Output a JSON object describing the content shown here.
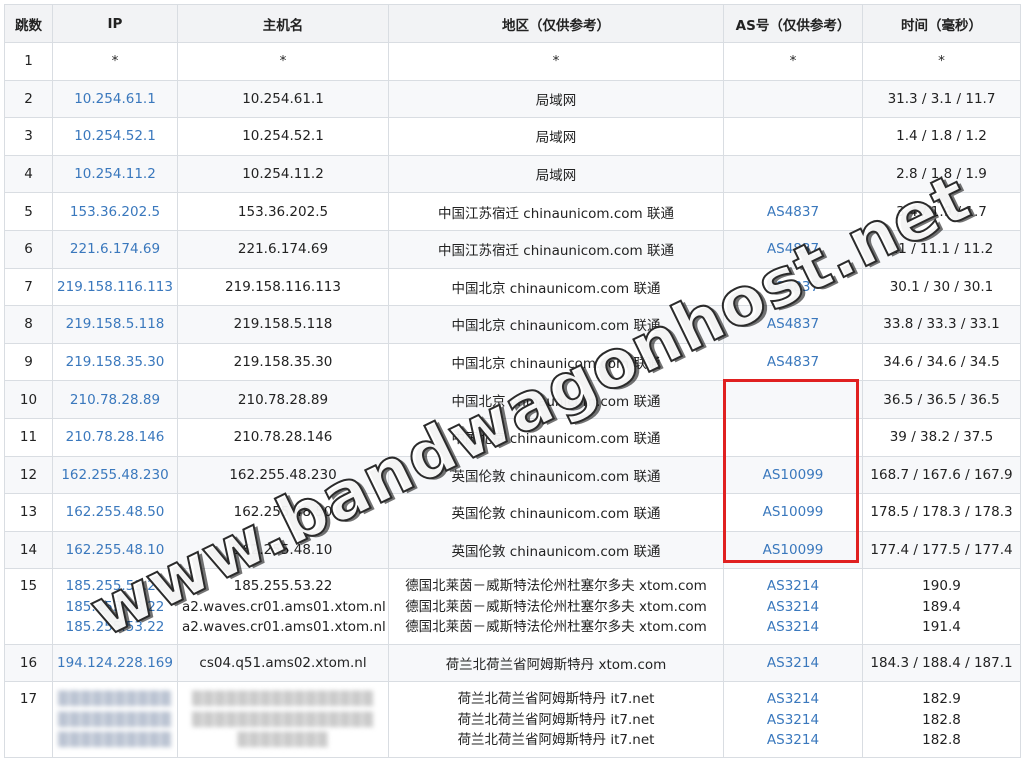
{
  "headers": {
    "hop": "跳数",
    "ip": "IP",
    "host": "主机名",
    "region": "地区（仅供参考）",
    "as": "AS号（仅供参考）",
    "time": "时间（毫秒）"
  },
  "rows": [
    {
      "hop": "1",
      "ips": [
        "*"
      ],
      "hosts": [
        "*"
      ],
      "regions": [
        "*"
      ],
      "as": [
        "*"
      ],
      "times": [
        "*"
      ]
    },
    {
      "hop": "2",
      "ips": [
        "10.254.61.1"
      ],
      "hosts": [
        "10.254.61.1"
      ],
      "regions": [
        "局域网"
      ],
      "as": [
        ""
      ],
      "times": [
        "31.3 / 3.1 / 11.7"
      ]
    },
    {
      "hop": "3",
      "ips": [
        "10.254.52.1"
      ],
      "hosts": [
        "10.254.52.1"
      ],
      "regions": [
        "局域网"
      ],
      "as": [
        ""
      ],
      "times": [
        "1.4 / 1.8 / 1.2"
      ]
    },
    {
      "hop": "4",
      "ips": [
        "10.254.11.2"
      ],
      "hosts": [
        "10.254.11.2"
      ],
      "regions": [
        "局域网"
      ],
      "as": [
        ""
      ],
      "times": [
        "2.8 / 1.8 / 1.9"
      ]
    },
    {
      "hop": "5",
      "ips": [
        "153.36.202.5"
      ],
      "hosts": [
        "153.36.202.5"
      ],
      "regions": [
        "中国江苏宿迁 chinaunicom.com 联通"
      ],
      "as": [
        "AS4837"
      ],
      "times": [
        "3.4 / 1.9 / 1.7"
      ]
    },
    {
      "hop": "6",
      "ips": [
        "221.6.174.69"
      ],
      "hosts": [
        "221.6.174.69"
      ],
      "regions": [
        "中国江苏宿迁 chinaunicom.com 联通"
      ],
      "as": [
        "AS4837"
      ],
      "times": [
        "11 / 11.1 / 11.2"
      ]
    },
    {
      "hop": "7",
      "ips": [
        "219.158.116.113"
      ],
      "hosts": [
        "219.158.116.113"
      ],
      "regions": [
        "中国北京 chinaunicom.com 联通"
      ],
      "as": [
        "AS4837"
      ],
      "times": [
        "30.1 / 30 / 30.1"
      ]
    },
    {
      "hop": "8",
      "ips": [
        "219.158.5.118"
      ],
      "hosts": [
        "219.158.5.118"
      ],
      "regions": [
        "中国北京 chinaunicom.com 联通"
      ],
      "as": [
        "AS4837"
      ],
      "times": [
        "33.8 / 33.3 / 33.1"
      ]
    },
    {
      "hop": "9",
      "ips": [
        "219.158.35.30"
      ],
      "hosts": [
        "219.158.35.30"
      ],
      "regions": [
        "中国北京 chinaunicom.com 联通"
      ],
      "as": [
        "AS4837"
      ],
      "times": [
        "34.6 / 34.6 / 34.5"
      ]
    },
    {
      "hop": "10",
      "ips": [
        "210.78.28.89"
      ],
      "hosts": [
        "210.78.28.89"
      ],
      "regions": [
        "中国北京 chinaunicom.com 联通"
      ],
      "as": [
        ""
      ],
      "times": [
        "36.5 / 36.5 / 36.5"
      ]
    },
    {
      "hop": "11",
      "ips": [
        "210.78.28.146"
      ],
      "hosts": [
        "210.78.28.146"
      ],
      "regions": [
        "中国北京 chinaunicom.com 联通"
      ],
      "as": [
        ""
      ],
      "times": [
        "39 / 38.2 / 37.5"
      ]
    },
    {
      "hop": "12",
      "ips": [
        "162.255.48.230"
      ],
      "hosts": [
        "162.255.48.230"
      ],
      "regions": [
        "英国伦敦 chinaunicom.com 联通"
      ],
      "as": [
        "AS10099"
      ],
      "times": [
        "168.7 / 167.6 / 167.9"
      ]
    },
    {
      "hop": "13",
      "ips": [
        "162.255.48.50"
      ],
      "hosts": [
        "162.255.48.50"
      ],
      "regions": [
        "英国伦敦 chinaunicom.com 联通"
      ],
      "as": [
        "AS10099"
      ],
      "times": [
        "178.5 / 178.3 / 178.3"
      ]
    },
    {
      "hop": "14",
      "ips": [
        "162.255.48.10"
      ],
      "hosts": [
        "162.255.48.10"
      ],
      "regions": [
        "英国伦敦 chinaunicom.com 联通"
      ],
      "as": [
        "AS10099"
      ],
      "times": [
        "177.4 / 177.5 / 177.4"
      ]
    },
    {
      "hop": "15",
      "ips": [
        "185.255.53.22",
        "185.255.53.22",
        "185.255.53.22"
      ],
      "hosts": [
        "185.255.53.22",
        "a2.waves.cr01.ams01.xtom.nl",
        "a2.waves.cr01.ams01.xtom.nl"
      ],
      "regions": [
        "德国北莱茵－威斯特法伦州杜塞尔多夫 xtom.com",
        "德国北莱茵－威斯特法伦州杜塞尔多夫 xtom.com",
        "德国北莱茵－威斯特法伦州杜塞尔多夫 xtom.com"
      ],
      "as": [
        "AS3214",
        "AS3214",
        "AS3214"
      ],
      "times": [
        "190.9",
        "189.4",
        "191.4"
      ]
    },
    {
      "hop": "16",
      "ips": [
        "194.124.228.169"
      ],
      "hosts": [
        "cs04.q51.ams02.xtom.nl"
      ],
      "regions": [
        "荷兰北荷兰省阿姆斯特丹 xtom.com"
      ],
      "as": [
        "AS3214"
      ],
      "times": [
        "184.3 / 188.4 / 187.1"
      ]
    },
    {
      "hop": "17",
      "blurred": true,
      "regions": [
        "荷兰北荷兰省阿姆斯特丹 it7.net",
        "荷兰北荷兰省阿姆斯特丹 it7.net",
        "荷兰北荷兰省阿姆斯特丹 it7.net"
      ],
      "as": [
        "AS3214",
        "AS3214",
        "AS3214"
      ],
      "times": [
        "182.9",
        "182.8",
        "182.8"
      ]
    }
  ],
  "watermark": "www.bandwagonhost.net",
  "colors": {
    "link": "#3a78bd",
    "highlight_box": "#e02020"
  }
}
